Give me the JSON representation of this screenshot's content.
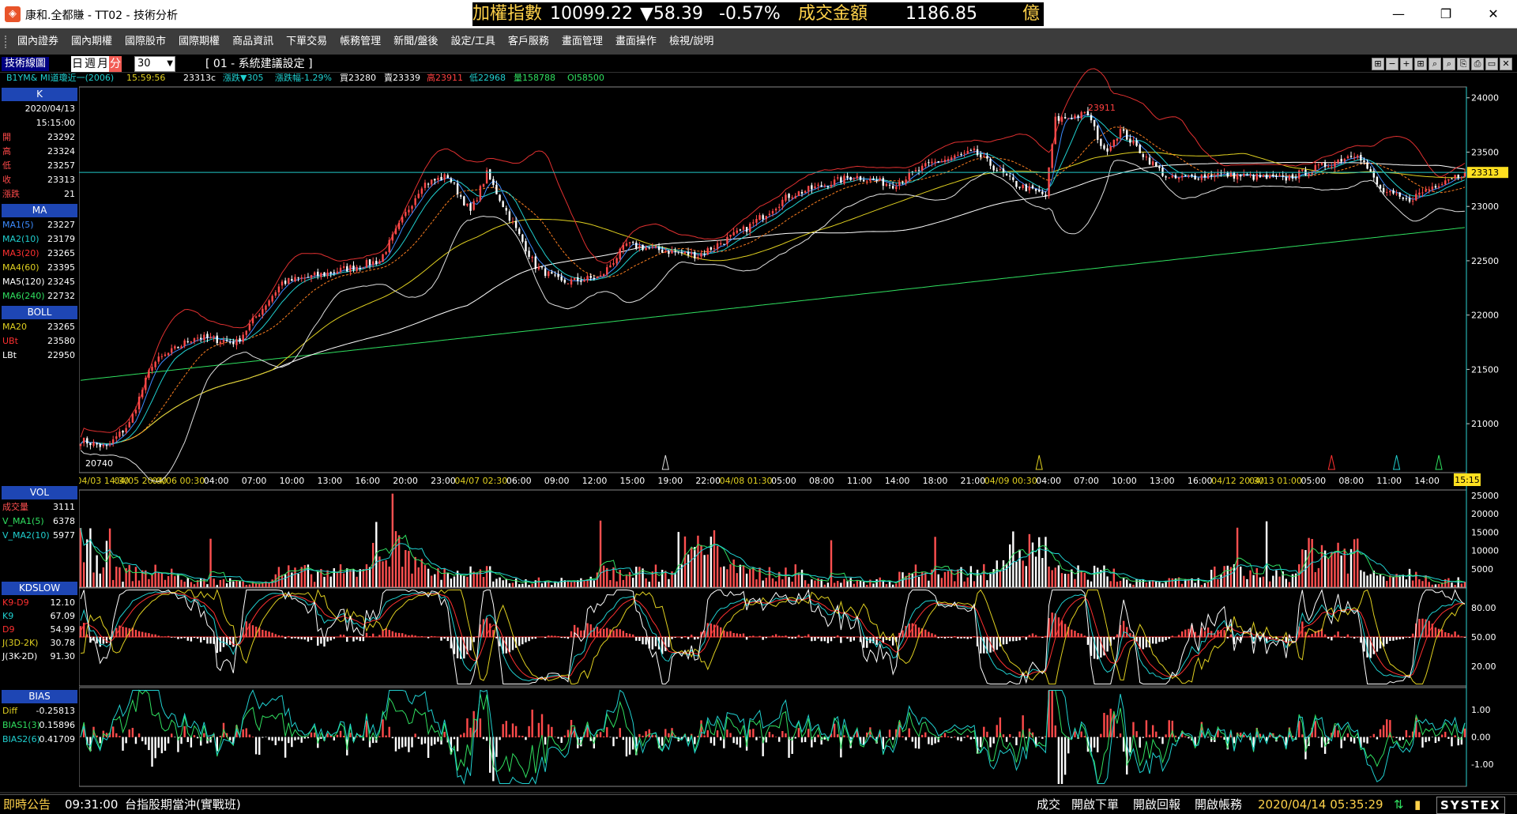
{
  "window": {
    "title": "康和.全都賺 - TT02 - 技術分析",
    "min_label": "—",
    "max_label": "❐",
    "close_label": "✕"
  },
  "ticker": {
    "index_label": "加權指數",
    "index_value": "10099.22",
    "change": "▼58.39",
    "change_pct": "-0.57%",
    "turnover_label": "成交金額",
    "turnover_value": "1186.85",
    "turnover_unit": "億"
  },
  "menu": [
    "國內證券",
    "國內期權",
    "國際股市",
    "國際期權",
    "商品資訊",
    "下單交易",
    "帳務管理",
    "新聞/盤後",
    "設定/工具",
    "客戶服務",
    "畫面管理",
    "畫面操作",
    "檢視/說明"
  ],
  "toolbar": {
    "chart_title": "技術線圖",
    "period_tabs": [
      "日",
      "週",
      "月",
      "分"
    ],
    "period_active": 3,
    "period_value": "30",
    "settings_label": "[ 01 - 系統建議設定 ]",
    "tools": [
      "⊞",
      "−",
      "+",
      "⊞",
      "⌕",
      "⌕",
      "⎘",
      "⎙",
      "▭",
      "✕"
    ]
  },
  "info": {
    "symbol": "B1YM& MI道瓊近一(2006)",
    "time": "15:59:56",
    "last": "23313c",
    "change": "漲跌▼305",
    "change_pct": "漲跌幅-1.29%",
    "bid": "買23280",
    "ask": "賣23339",
    "high": "高23911",
    "low": "低22968",
    "volume": "量158788",
    "oi": "OI58500"
  },
  "panel": {
    "k_head": "K",
    "date": "2020/04/13",
    "time": "15:15:00",
    "open_label": "開",
    "open": "23292",
    "high_label": "高",
    "high": "23324",
    "low_label": "低",
    "low": "23257",
    "close_label": "收",
    "close": "23313",
    "chg_label": "漲跌",
    "chg": "21",
    "ma_head": "MA",
    "ma": [
      {
        "label": "MA1(5)",
        "value": "23227",
        "color": "#3c8cff"
      },
      {
        "label": "MA2(10)",
        "value": "23179",
        "color": "#20d0d0"
      },
      {
        "label": "MA3(20)",
        "value": "23265",
        "color": "#ff3030"
      },
      {
        "label": "MA4(60)",
        "value": "23395",
        "color": "#e0d020"
      },
      {
        "label": "MA5(120)",
        "value": "23245",
        "color": "#ffffff"
      },
      {
        "label": "MA6(240)",
        "value": "22732",
        "color": "#30e060"
      }
    ],
    "boll_head": "BOLL",
    "boll": [
      {
        "label": "MA20",
        "value": "23265",
        "color": "#e0d020"
      },
      {
        "label": "UBt",
        "value": "23580",
        "color": "#ff3030"
      },
      {
        "label": "LBt",
        "value": "22950",
        "color": "#ffffff"
      }
    ],
    "vol_head": "VOL",
    "vol": [
      {
        "label": "成交量",
        "value": "3111",
        "color": "#ff5050"
      },
      {
        "label": "V_MA1(5)",
        "value": "6378",
        "color": "#30e060"
      },
      {
        "label": "V_MA2(10)",
        "value": "5977",
        "color": "#20d0d0"
      }
    ],
    "kd_head": "KDSLOW",
    "kd": [
      {
        "label": "K9-D9",
        "value": "12.10",
        "color": "#ff3030"
      },
      {
        "label": "K9",
        "value": "67.09",
        "color": "#20d0d0"
      },
      {
        "label": "D9",
        "value": "54.99",
        "color": "#ff3030"
      },
      {
        "label": "J(3D-2K)",
        "value": "30.78",
        "color": "#e0d020"
      },
      {
        "label": "J(3K-2D)",
        "value": "91.30",
        "color": "#ffffff"
      }
    ],
    "bias_head": "BIAS",
    "bias": [
      {
        "label": "Diff",
        "value": "-0.25813",
        "color": "#e0d020"
      },
      {
        "label": "BIAS1(3)",
        "value": "0.15896",
        "color": "#30e060"
      },
      {
        "label": "BIAS2(6)",
        "value": "0.41709",
        "color": "#20d0d0"
      }
    ]
  },
  "chart_data": [
    {
      "type": "candlestick",
      "title": "",
      "y_ticks": [
        21000,
        21500,
        22000,
        22500,
        23000,
        23500,
        24000
      ],
      "ylim": [
        20550,
        24100
      ],
      "last_price_label": "23313",
      "high_marker": "23911",
      "low_marker": "20740",
      "x_tick_labels": [
        "04/03 14:30",
        "04/05 20:00",
        "04/06 00:30",
        "04:00",
        "07:00",
        "10:00",
        "13:00",
        "16:00",
        "20:00",
        "23:00",
        "04/07 02:30",
        "06:00",
        "09:00",
        "12:00",
        "15:00",
        "19:00",
        "22:00",
        "04/08 01:30",
        "05:00",
        "08:00",
        "11:00",
        "14:00",
        "18:00",
        "21:00",
        "04/09 00:30",
        "04:00",
        "07:00",
        "10:00",
        "13:00",
        "16:00",
        "04/12 20:30",
        "04/13 01:00",
        "05:00",
        "08:00",
        "11:00",
        "14:00"
      ],
      "cursor_time": "15:15",
      "keypoints": [
        [
          0,
          20850
        ],
        [
          8,
          20780
        ],
        [
          15,
          21000
        ],
        [
          22,
          21550
        ],
        [
          35,
          21800
        ],
        [
          48,
          21750
        ],
        [
          62,
          22300
        ],
        [
          75,
          22380
        ],
        [
          92,
          22500
        ],
        [
          105,
          23200
        ],
        [
          113,
          23280
        ],
        [
          120,
          22950
        ],
        [
          125,
          23300
        ],
        [
          132,
          22900
        ],
        [
          140,
          22450
        ],
        [
          148,
          22300
        ],
        [
          160,
          22350
        ],
        [
          168,
          22650
        ],
        [
          178,
          22600
        ],
        [
          190,
          22550
        ],
        [
          205,
          22800
        ],
        [
          218,
          23100
        ],
        [
          238,
          23280
        ],
        [
          250,
          23200
        ],
        [
          262,
          23400
        ],
        [
          275,
          23500
        ],
        [
          288,
          23200
        ],
        [
          297,
          23100
        ],
        [
          300,
          23800
        ],
        [
          310,
          23850
        ],
        [
          315,
          23500
        ],
        [
          320,
          23700
        ],
        [
          328,
          23450
        ],
        [
          335,
          23250
        ],
        [
          350,
          23300
        ],
        [
          370,
          23250
        ],
        [
          385,
          23400
        ],
        [
          393,
          23500
        ],
        [
          400,
          23150
        ],
        [
          408,
          23050
        ],
        [
          420,
          23250
        ],
        [
          426,
          23313
        ]
      ]
    },
    {
      "type": "bar",
      "title": "VOL",
      "y_ticks": [
        5000,
        10000,
        15000,
        20000,
        25000
      ],
      "ylim": [
        0,
        26500
      ]
    },
    {
      "type": "line",
      "title": "KDSLOW",
      "y_ticks": [
        20,
        50,
        80
      ],
      "ylim": [
        0,
        100
      ]
    },
    {
      "type": "bar",
      "title": "BIAS",
      "y_ticks": [
        1.0,
        0.0,
        -1.0
      ],
      "ylim": [
        -1.8,
        1.8
      ]
    }
  ],
  "statusbar": {
    "news_label": "即時公告",
    "news_time": "09:31:00",
    "news_text": "台指股期當沖(實戰班)",
    "btn_deal": "成交",
    "btn_order": "開啟下單",
    "btn_report": "開啟回報",
    "btn_account": "開啟帳務",
    "datetime": "2020/04/14 05:35:29",
    "brand": "SYSTEX"
  },
  "colors": {
    "up": "#ff4a4a",
    "down": "#ffffff",
    "accent": "#ffd24a",
    "header_blue": "#1e46b4",
    "cursor": "#20c8c8"
  }
}
